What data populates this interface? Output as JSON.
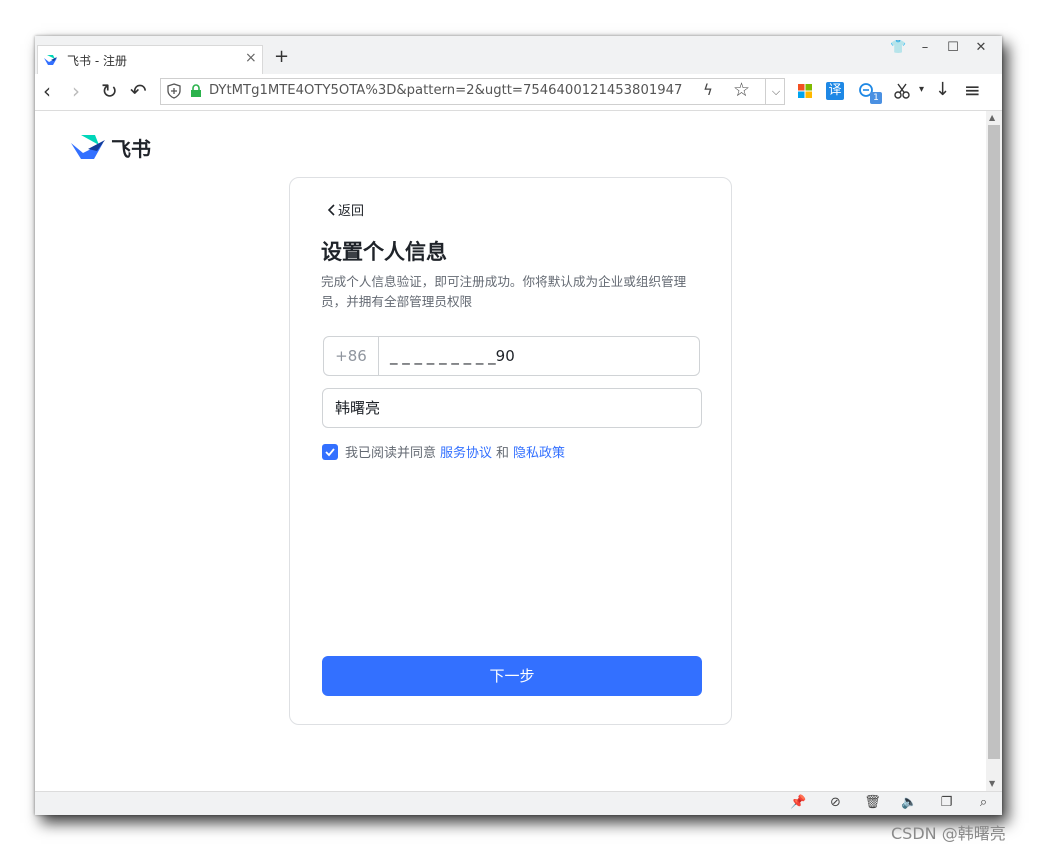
{
  "browser": {
    "tab_title": "飞书 - 注册",
    "tab_close": "×",
    "new_tab": "+",
    "window_controls": [
      "👕",
      "–",
      "☐",
      "✕"
    ],
    "nav": {
      "back": "‹",
      "forward": "›",
      "reload": "↻",
      "undo": "↶"
    },
    "url": "DYtMTg1MTE4OTY5OTA%3D&pattern=2&ugtt=7546400121453801947",
    "url_actions": {
      "bolt": "ϟ",
      "star": "☆",
      "dropdown": "⌵"
    },
    "ext_icons": [
      "windows-tiles-icon",
      "translate-icon",
      "search-extension-icon",
      "scissors-icon",
      "download-icon",
      "menu-icon"
    ],
    "translate_label": "译",
    "ext_badge": "1",
    "ext_more": "▾",
    "download": "↓",
    "menu": "≡",
    "status_icons": [
      "pin-icon",
      "compass-icon",
      "trash-icon",
      "sound-icon",
      "window-icon",
      "zoom-icon"
    ]
  },
  "page": {
    "brand": "飞书",
    "back_label": "返回",
    "title": "设置个人信息",
    "description": "完成个人信息验证，即可注册成功。你将默认成为企业或组织管理员，并拥有全部管理员权限",
    "phone": {
      "country_code": "+86",
      "value": "_ _ _ _ _ _ _ _ _90"
    },
    "name": {
      "value": "韩曙亮"
    },
    "agree": {
      "prefix": "我已阅读并同意",
      "terms": "服务协议",
      "and": "和",
      "privacy": "隐私政策"
    },
    "next_button": "下一步"
  },
  "watermark": "CSDN @韩曙亮",
  "colors": {
    "accent": "#3370ff",
    "text": "#1f2329",
    "muted": "#646a73"
  }
}
